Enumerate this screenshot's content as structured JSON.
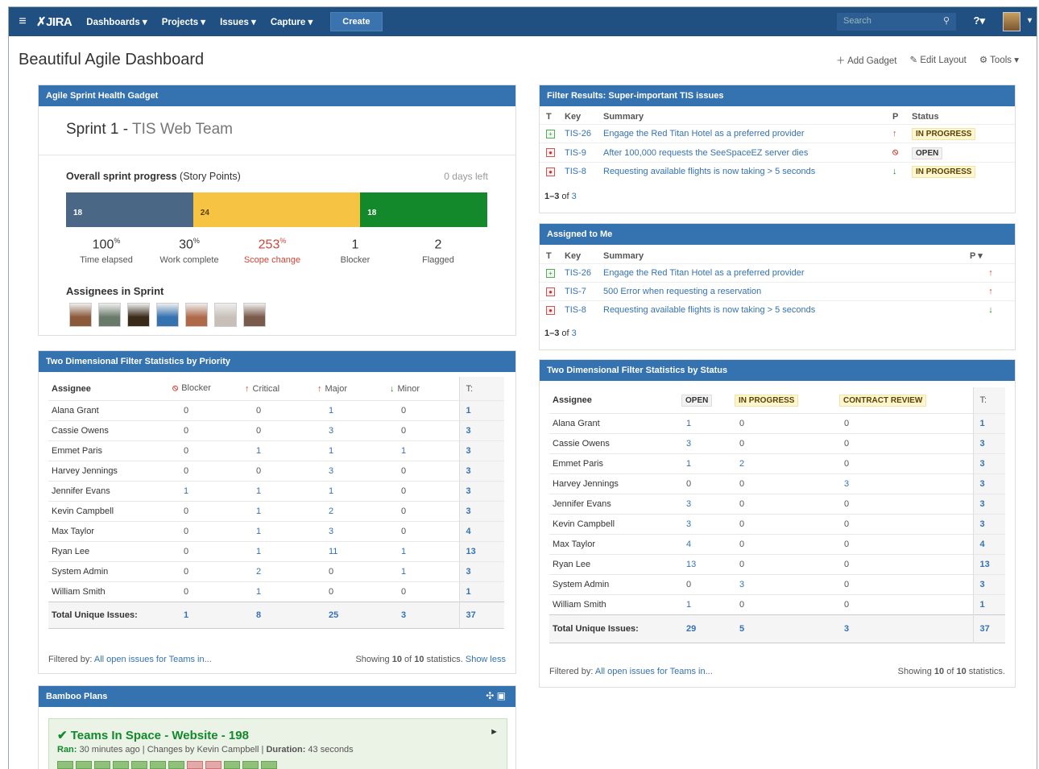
{
  "nav": {
    "logo": "JIRA",
    "items": [
      "Dashboards ▾",
      "Projects ▾",
      "Issues ▾",
      "Capture ▾"
    ],
    "create": "Create",
    "search_placeholder": "Search",
    "help": "?▾"
  },
  "page": {
    "title": "Beautiful Agile Dashboard",
    "add_gadget": "Add Gadget",
    "edit_layout": "Edit Layout",
    "tools": "Tools ▾"
  },
  "sprint": {
    "header": "Agile Sprint Health Gadget",
    "sprint_name": "Sprint 1 - ",
    "team": "TIS Web Team",
    "progress_label": "Overall sprint progress",
    "progress_unit": "(Story Points)",
    "days_left": "0 days left",
    "bar": [
      {
        "value": "18",
        "color": "#4a6785",
        "fraction": 0.3
      },
      {
        "value": "24",
        "color": "#f6c342",
        "fraction": 0.4
      },
      {
        "value": "18",
        "color": "#14892c",
        "fraction": 0.3
      }
    ],
    "stats": [
      {
        "value": "100",
        "unit": "%",
        "label": "Time elapsed",
        "color": "#333"
      },
      {
        "value": "30",
        "unit": "%",
        "label": "Work complete",
        "color": "#333"
      },
      {
        "value": "253",
        "unit": "%",
        "label": "Scope change",
        "color": "#d04437"
      },
      {
        "value": "1",
        "unit": "",
        "label": "Blocker",
        "color": "#333"
      },
      {
        "value": "2",
        "unit": "",
        "label": "Flagged",
        "color": "#333"
      }
    ],
    "assignees_label": "Assignees in Sprint"
  },
  "filter_results": {
    "header": "Filter Results: Super-important TIS issues",
    "cols": [
      "T",
      "Key",
      "Summary",
      "P",
      "Status"
    ],
    "rows": [
      {
        "type": "story",
        "key": "TIS-26",
        "summary": "Engage the Red Titan Hotel as a preferred provider",
        "priority": "↑",
        "status": "IN PROGRESS",
        "status_kind": "inprogress"
      },
      {
        "type": "bug",
        "key": "TIS-9",
        "summary": "After 100,000 requests the SeeSpaceEZ server dies",
        "priority": "⦸",
        "status": "OPEN",
        "status_kind": "open"
      },
      {
        "type": "bug",
        "key": "TIS-8",
        "summary": "Requesting available flights is now taking > 5 seconds",
        "priority": "↓",
        "status": "IN PROGRESS",
        "status_kind": "inprogress"
      }
    ],
    "count_a": "1–3",
    "count_b": " of ",
    "count_c": "3"
  },
  "assigned": {
    "header": "Assigned to Me",
    "cols": [
      "T",
      "Key",
      "Summary",
      "P ▾"
    ],
    "rows": [
      {
        "type": "story",
        "key": "TIS-26",
        "summary": "Engage the Red Titan Hotel as a preferred provider",
        "priority": "↑"
      },
      {
        "type": "bug",
        "key": "TIS-7",
        "summary": "500 Error when requesting a reservation",
        "priority": "↑"
      },
      {
        "type": "bug",
        "key": "TIS-8",
        "summary": "Requesting available flights is now taking > 5 seconds",
        "priority": "↓"
      }
    ],
    "count_a": "1–3",
    "count_b": " of ",
    "count_c": "3"
  },
  "priority_stats": {
    "header": "Two Dimensional Filter Statistics by Priority",
    "cols": [
      {
        "icon": "⦸",
        "label": "Blocker",
        "color": "#d04437"
      },
      {
        "icon": "↑",
        "label": "Critical",
        "color": "#d04437"
      },
      {
        "icon": "↑",
        "label": "Major",
        "color": "#d04437"
      },
      {
        "icon": "↓",
        "label": "Minor",
        "color": "#14892c"
      }
    ],
    "assignee_label": "Assignee",
    "total_col": "T:",
    "rows": [
      {
        "name": "Alana Grant",
        "v": [
          "0",
          "0",
          "1",
          "0"
        ],
        "t": "1"
      },
      {
        "name": "Cassie Owens",
        "v": [
          "0",
          "0",
          "3",
          "0"
        ],
        "t": "3"
      },
      {
        "name": "Emmet Paris",
        "v": [
          "0",
          "1",
          "1",
          "1"
        ],
        "t": "3"
      },
      {
        "name": "Harvey Jennings",
        "v": [
          "0",
          "0",
          "3",
          "0"
        ],
        "t": "3"
      },
      {
        "name": "Jennifer Evans",
        "v": [
          "1",
          "1",
          "1",
          "0"
        ],
        "t": "3"
      },
      {
        "name": "Kevin Campbell",
        "v": [
          "0",
          "1",
          "2",
          "0"
        ],
        "t": "3"
      },
      {
        "name": "Max Taylor",
        "v": [
          "0",
          "1",
          "3",
          "0"
        ],
        "t": "4"
      },
      {
        "name": "Ryan Lee",
        "v": [
          "0",
          "1",
          "11",
          "1"
        ],
        "t": "13"
      },
      {
        "name": "System Admin",
        "v": [
          "0",
          "2",
          "0",
          "1"
        ],
        "t": "3"
      },
      {
        "name": "William Smith",
        "v": [
          "0",
          "1",
          "0",
          "0"
        ],
        "t": "1"
      }
    ],
    "total_label": "Total Unique Issues:",
    "totals": [
      "1",
      "8",
      "25",
      "3"
    ],
    "grand_total": "37",
    "filtered_by": "Filtered by: ",
    "filter_link": "All open issues for Teams in...",
    "showing_pre": "Showing ",
    "showing_a": "10",
    "showing_mid": " of ",
    "showing_b": "10",
    "showing_post": " statistics. ",
    "show_less": "Show less"
  },
  "status_stats": {
    "header": "Two Dimensional Filter Statistics by Status",
    "cols": [
      {
        "label": "OPEN",
        "kind": "open"
      },
      {
        "label": "IN PROGRESS",
        "kind": "inprogress"
      },
      {
        "label": "CONTRACT REVIEW",
        "kind": "inprogress"
      }
    ],
    "assignee_label": "Assignee",
    "total_col": "T:",
    "rows": [
      {
        "name": "Alana Grant",
        "v": [
          "1",
          "0",
          "0"
        ],
        "t": "1"
      },
      {
        "name": "Cassie Owens",
        "v": [
          "3",
          "0",
          "0"
        ],
        "t": "3"
      },
      {
        "name": "Emmet Paris",
        "v": [
          "1",
          "2",
          "0"
        ],
        "t": "3"
      },
      {
        "name": "Harvey Jennings",
        "v": [
          "0",
          "0",
          "3"
        ],
        "t": "3"
      },
      {
        "name": "Jennifer Evans",
        "v": [
          "3",
          "0",
          "0"
        ],
        "t": "3"
      },
      {
        "name": "Kevin Campbell",
        "v": [
          "3",
          "0",
          "0"
        ],
        "t": "3"
      },
      {
        "name": "Max Taylor",
        "v": [
          "4",
          "0",
          "0"
        ],
        "t": "4"
      },
      {
        "name": "Ryan Lee",
        "v": [
          "13",
          "0",
          "0"
        ],
        "t": "13"
      },
      {
        "name": "System Admin",
        "v": [
          "0",
          "3",
          "0"
        ],
        "t": "3"
      },
      {
        "name": "William Smith",
        "v": [
          "1",
          "0",
          "0"
        ],
        "t": "1"
      }
    ],
    "total_label": "Total Unique Issues:",
    "totals": [
      "29",
      "5",
      "3"
    ],
    "grand_total": "37",
    "filtered_by": "Filtered by: ",
    "filter_link": "All open issues for Teams in...",
    "showing_pre": "Showing ",
    "showing_a": "10",
    "showing_mid": " of ",
    "showing_b": "10",
    "showing_post": " statistics."
  },
  "bamboo": {
    "header": "Bamboo Plans",
    "plan": "Teams In Space - Website - 198",
    "ran_label": "Ran:",
    "ran": " 30 minutes ago | Changes by Kevin Campbell | ",
    "duration_label": "Duration:",
    "duration": " 43 seconds",
    "builds": [
      "pass",
      "pass",
      "pass",
      "pass",
      "pass",
      "pass",
      "pass",
      "fail",
      "fail",
      "pass",
      "pass",
      "pass"
    ]
  }
}
